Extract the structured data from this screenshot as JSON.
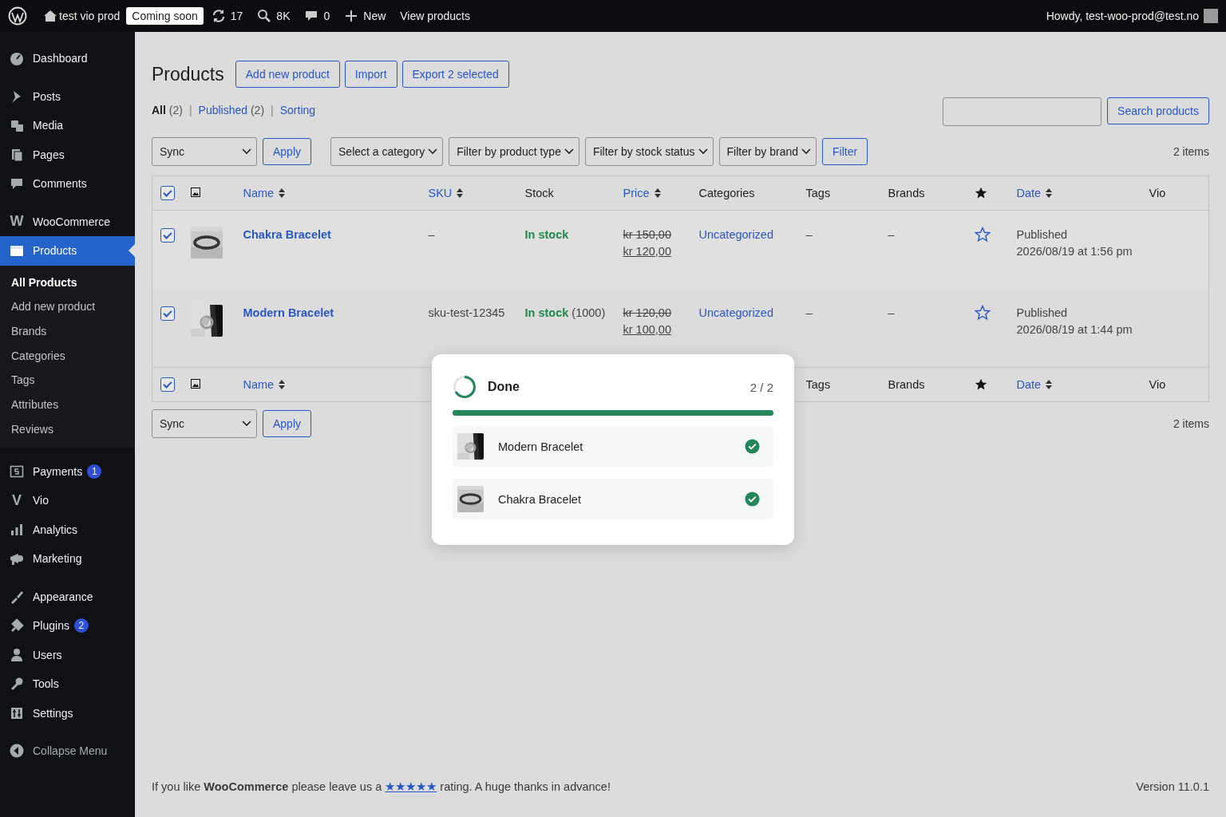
{
  "admin_bar": {
    "site": "test vio prod",
    "site_badge": "Coming soon",
    "updates": "17",
    "search_count": "8K",
    "comments": "0",
    "new": "New",
    "view": "View products",
    "howdy": "Howdy, test-woo-prod@test.no"
  },
  "sidebar": {
    "groups": [
      {
        "items": [
          {
            "label": "Dashboard",
            "selected": false
          }
        ]
      },
      {
        "items": [
          {
            "label": "Posts",
            "selected": false
          },
          {
            "label": "Media",
            "selected": false
          },
          {
            "label": "Pages",
            "selected": false
          },
          {
            "label": "Comments",
            "selected": false
          }
        ]
      },
      {
        "items": [
          {
            "label": "WooCommerce",
            "selected": false,
            "icon_text": "W"
          },
          {
            "label": "Products",
            "selected": true,
            "children": [
              {
                "label": "All Products",
                "selected": true
              },
              {
                "label": "Add new product",
                "selected": false
              },
              {
                "label": "Brands",
                "selected": false
              },
              {
                "label": "Categories",
                "selected": false
              },
              {
                "label": "Tags",
                "selected": false
              },
              {
                "label": "Attributes",
                "selected": false
              },
              {
                "label": "Reviews",
                "selected": false
              }
            ]
          }
        ]
      },
      {
        "items": [
          {
            "label": "Payments",
            "selected": false,
            "badge": "1"
          },
          {
            "label": "Vio",
            "selected": false,
            "icon_text": "V"
          },
          {
            "label": "Analytics",
            "selected": false
          },
          {
            "label": "Marketing",
            "selected": false
          }
        ]
      },
      {
        "items": [
          {
            "label": "Appearance",
            "selected": false
          },
          {
            "label": "Plugins",
            "selected": false,
            "badge": "2"
          },
          {
            "label": "Users",
            "selected": false
          },
          {
            "label": "Tools",
            "selected": false
          },
          {
            "label": "Settings",
            "selected": false
          }
        ]
      }
    ],
    "collapse": "Collapse Menu"
  },
  "page": {
    "title": "Products",
    "actions": [
      "Add new product",
      "Import",
      "Export 2 selected"
    ],
    "view_separator": "|",
    "views": [
      {
        "label": "All",
        "count": "(2)",
        "selected": true
      },
      {
        "label": "Published",
        "count": "(2)",
        "selected": false
      },
      {
        "label": "Sorting",
        "selected": false
      }
    ],
    "search_button": "Search products",
    "bulk_action": "Sync",
    "apply": "Apply",
    "filters": [
      "Select a category",
      "Filter by product type",
      "Filter by stock status",
      "Filter by brand"
    ],
    "filter_button": "Filter",
    "items_count": "2 items"
  },
  "table": {
    "header": {
      "checked": true,
      "columns": [
        {
          "label": "Name",
          "kind": "sortable"
        },
        {
          "label": "SKU",
          "kind": "sortable"
        },
        {
          "label": "Stock",
          "kind": "plain"
        },
        {
          "label": "Price",
          "kind": "sortable"
        },
        {
          "label": "Categories",
          "kind": "plain"
        },
        {
          "label": "Tags",
          "kind": "plain"
        },
        {
          "label": "Brands",
          "kind": "plain"
        },
        {
          "kind": "featured"
        },
        {
          "label": "Date",
          "kind": "sortable"
        },
        {
          "label": "Vio",
          "kind": "plain"
        }
      ]
    },
    "rows": [
      {
        "checked": true,
        "name": "Chakra Bracelet",
        "sku": "–",
        "stock_status": "In stock",
        "price_regular": "kr 150,00",
        "price_sale": "kr 120,00",
        "category": "Uncategorized",
        "tags": "–",
        "brands": "–",
        "featured": false,
        "status": "Published",
        "date": "2026/08/19 at 1:56 pm"
      },
      {
        "checked": true,
        "name": "Modern Bracelet",
        "sku": "sku-test-12345",
        "stock_status": "In stock",
        "stock_count": "(1000)",
        "price_regular": "kr 120,00",
        "price_sale": "kr 100,00",
        "category": "Uncategorized",
        "tags": "–",
        "brands": "–",
        "featured": false,
        "status": "Published",
        "date": "2026/08/19 at 1:44 pm"
      }
    ],
    "footer": {
      "checked": true,
      "columns_left": [
        {
          "label": "Name",
          "kind": "sortable"
        }
      ],
      "columns_right": [
        {
          "label": "Tags",
          "kind": "plain"
        },
        {
          "label": "Brands",
          "kind": "plain"
        },
        {
          "kind": "featured"
        },
        {
          "label": "Date",
          "kind": "sortable"
        },
        {
          "label": "Vio",
          "kind": "plain"
        }
      ]
    }
  },
  "bottom_bar": {
    "bulk_action": "Sync",
    "apply": "Apply",
    "items_count": "2 items"
  },
  "dialog": {
    "title": "Done",
    "count": "2 / 2",
    "level": 1,
    "items": [
      {
        "name": "Modern Bracelet",
        "done": true
      },
      {
        "name": "Chakra Bracelet",
        "done": true
      }
    ]
  },
  "footer": {
    "text_before": "If you like **WooCommerce** please leave us a",
    "link": "★★★★★",
    "text_after": "rating. A huge thanks in advance!",
    "version": "Version 11.0.1"
  }
}
